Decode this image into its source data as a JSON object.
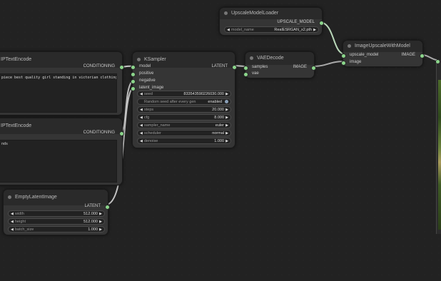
{
  "nodes": {
    "clip_top": {
      "title": "CLIPTextEncode",
      "title_visible": "IPTextEncode",
      "output": "CONDITIONING",
      "text": "piece best quality girl standing in victorian clothing"
    },
    "clip_bottom": {
      "title": "CLIPTextEncode",
      "title_visible": "IPTextEncode",
      "output": "CONDITIONING",
      "text": "nds"
    },
    "empty_latent": {
      "title": "EmptyLatentImage",
      "output": "LATENT",
      "widgets": [
        {
          "label": "width",
          "value": "512.000"
        },
        {
          "label": "height",
          "value": "512.000"
        },
        {
          "label": "batch_size",
          "value": "1.000"
        }
      ]
    },
    "ksampler": {
      "title": "KSampler",
      "inputs": [
        "model",
        "positive",
        "negative",
        "latent_image"
      ],
      "output": "LATENT",
      "widgets": [
        {
          "label": "seed",
          "value": "833543590226030.000"
        },
        {
          "label": "Random seed after every gen",
          "value": "enabled"
        },
        {
          "label": "steps",
          "value": "20.000"
        },
        {
          "label": "cfg",
          "value": "8.000"
        },
        {
          "label": "sampler_name",
          "value": "euler"
        },
        {
          "label": "scheduler",
          "value": "normal"
        },
        {
          "label": "denoise",
          "value": "1.000"
        }
      ]
    },
    "vae_decode": {
      "title": "VAEDecode",
      "inputs": [
        "samples",
        "vae"
      ],
      "output": "IMAGE"
    },
    "upscale_loader": {
      "title": "UpscaleModelLoader",
      "output": "UPSCALE_MODEL",
      "widget": {
        "label": "model_name",
        "value": "RealESRGAN_x2.pth"
      }
    },
    "image_upscale": {
      "title": "ImageUpscaleWithModel",
      "inputs": [
        "upscale_model",
        "image"
      ],
      "output": "IMAGE"
    }
  },
  "colors": {
    "link_latent": "#d7c9e6",
    "link_cond": "#d0d0a0",
    "link_model": "#a6e3a6",
    "pin": "#8bd68b"
  },
  "icons": {
    "arrow_left": "◀",
    "arrow_right": "▶",
    "node_dot": "circle"
  }
}
